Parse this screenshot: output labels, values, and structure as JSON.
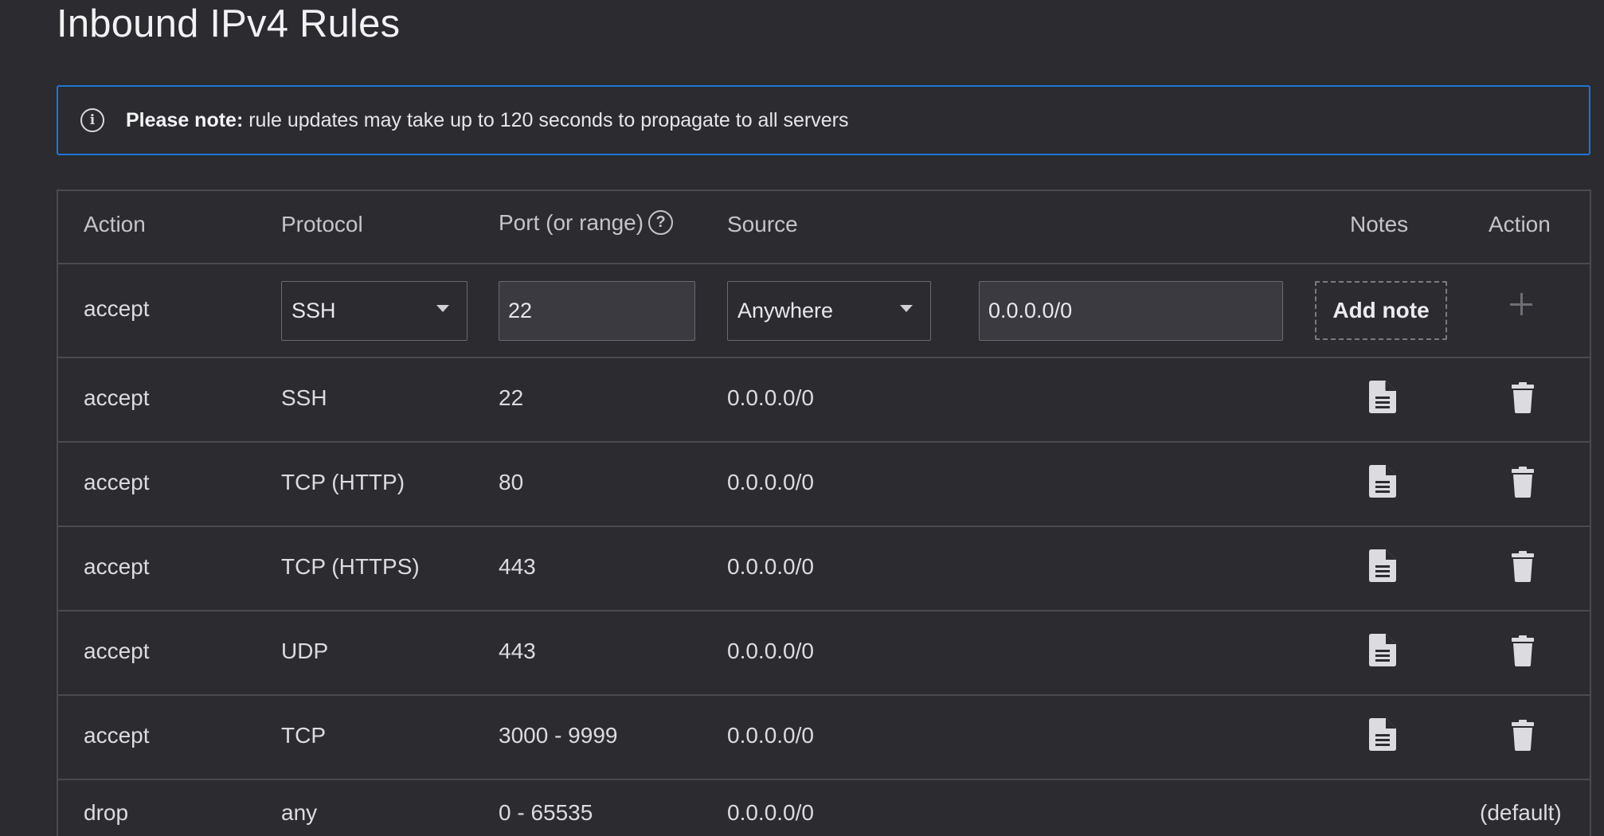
{
  "page": {
    "title": "Inbound IPv4 Rules"
  },
  "notice": {
    "icon": "info-icon",
    "bold": "Please note:",
    "text": " rule updates may take up to 120 seconds to propagate to all servers",
    "border_color": "#1e76d6"
  },
  "table": {
    "headers": {
      "action": "Action",
      "protocol": "Protocol",
      "port": "Port (or range)",
      "source": "Source",
      "notes": "Notes",
      "action2": "Action"
    },
    "new_rule": {
      "action": "accept",
      "protocol_selected": "SSH",
      "port_value": "22",
      "source_selected": "Anywhere",
      "source_value": "0.0.0.0/0",
      "add_note_label": "Add note",
      "add_icon": "plus-icon"
    },
    "rows": [
      {
        "action": "accept",
        "protocol": "SSH",
        "port": "22",
        "source": "0.0.0.0/0"
      },
      {
        "action": "accept",
        "protocol": "TCP (HTTP)",
        "port": "80",
        "source": "0.0.0.0/0"
      },
      {
        "action": "accept",
        "protocol": "TCP (HTTPS)",
        "port": "443",
        "source": "0.0.0.0/0"
      },
      {
        "action": "accept",
        "protocol": "UDP",
        "port": "443",
        "source": "0.0.0.0/0"
      },
      {
        "action": "accept",
        "protocol": "TCP",
        "port": "3000 - 9999",
        "source": "0.0.0.0/0"
      }
    ],
    "default_row": {
      "action": "drop",
      "protocol": "any",
      "port": "0 - 65535",
      "source": "0.0.0.0/0",
      "note": "(default)"
    },
    "row_icons": {
      "notes": "document-icon",
      "action": "trash-icon"
    }
  }
}
